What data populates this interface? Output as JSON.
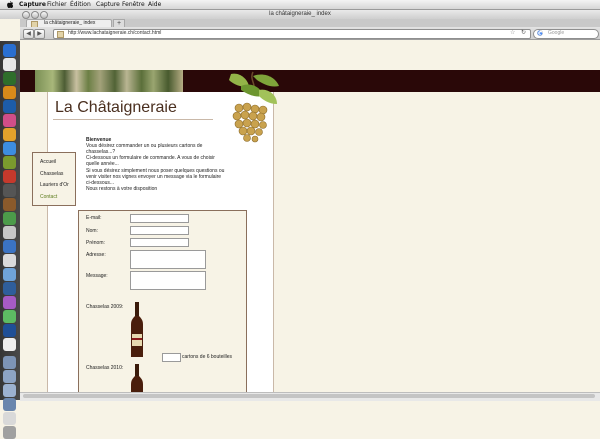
{
  "menubar": {
    "app": "Capture",
    "items": [
      "Fichier",
      "Édition",
      "Capture",
      "Fenêtre",
      "Aide"
    ]
  },
  "window": {
    "title": "la châtaigneraie_ index"
  },
  "tabs": [
    {
      "label": "la châtaigneraie_ index"
    }
  ],
  "toolbar": {
    "new_tab": "+",
    "back": "◀",
    "forward": "▶",
    "url": "http://www.lachataigneraie.ch/contact.html",
    "star": "☆",
    "reload": "↻",
    "search_placeholder": "Google"
  },
  "site": {
    "title": "La Châtaigneraie",
    "nav": [
      "Accueil",
      "Chasselas",
      "Lauriers d'Or",
      "Contact"
    ],
    "welcome": {
      "heading": "Bienvenue",
      "lines": [
        "Vous désirez commander un ou plusieurs cartons de",
        "chasselas...?",
        "Ci-dessous un formulaire de commande. A vous de choisir",
        "quelle année...",
        "Si vous désirez simplement nous poser quelques questions ou",
        "venir visiter nos vignes envoyer un message via le formulaire",
        "ci-dessous...",
        "Nous restons à votre disposition"
      ]
    },
    "form": {
      "email_label": "E-mail:",
      "nom_label": "Nom:",
      "prenom_label": "Prénom:",
      "adresse_label": "Adresse:",
      "message_label": "Message:",
      "chasselas_2009": "Chasselas 2009:",
      "cartons_label": "cartons de 6 bouteilles",
      "chasselas_2010": "Chasselas 2010:"
    }
  },
  "colors": {
    "page_bg": "#f7f3e6",
    "banner": "#2a0808",
    "title": "#4a2f1f",
    "active_nav": "#5a7a1a"
  }
}
